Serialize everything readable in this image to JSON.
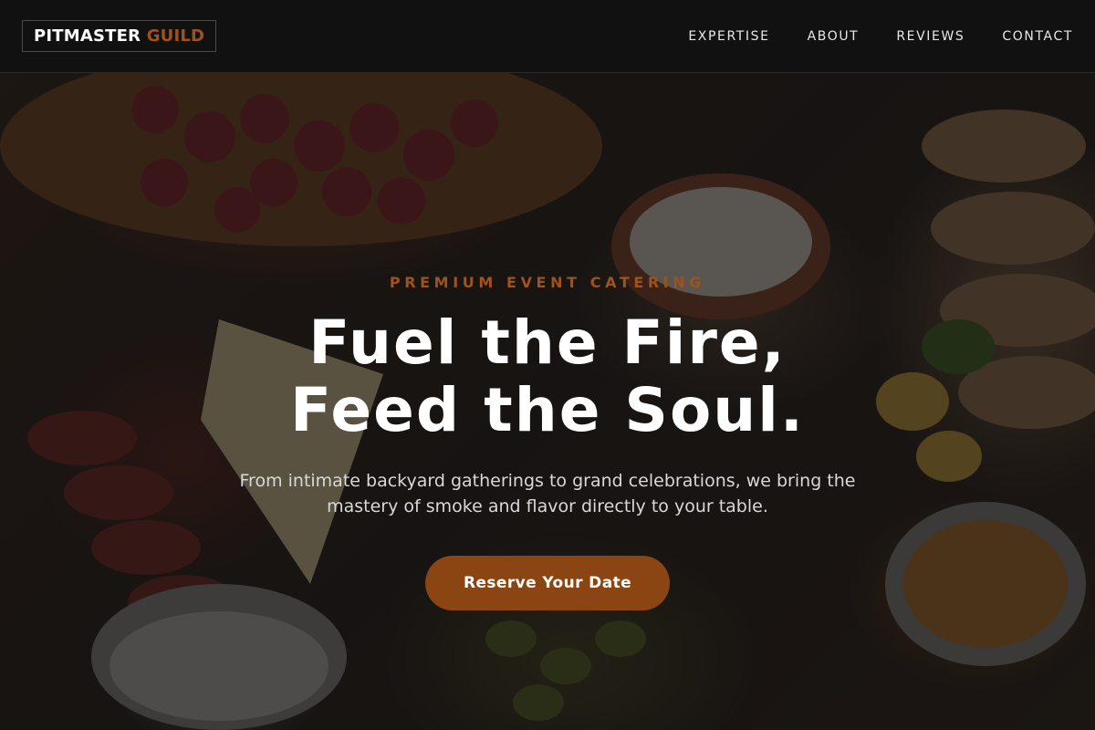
{
  "brand": {
    "name_primary": "PITMASTER",
    "name_accent": "GUILD"
  },
  "nav": {
    "links": [
      "EXPERTISE",
      "ABOUT",
      "REVIEWS",
      "CONTACT"
    ]
  },
  "hero": {
    "eyebrow": "PREMIUM EVENT CATERING",
    "headline_line1": "Fuel the Fire,",
    "headline_line2": "Feed the Soul.",
    "subtext": "From intimate backyard gatherings to grand celebrations, we bring the mastery of smoke and flavor directly to your table.",
    "cta_label": "Reserve Your Date",
    "background_image": "catering-food-spread-photo"
  },
  "colors": {
    "accent": "#a0521c",
    "cta_background": "#8b4513",
    "navbar_background": "#111111",
    "text_primary": "#ffffff"
  }
}
